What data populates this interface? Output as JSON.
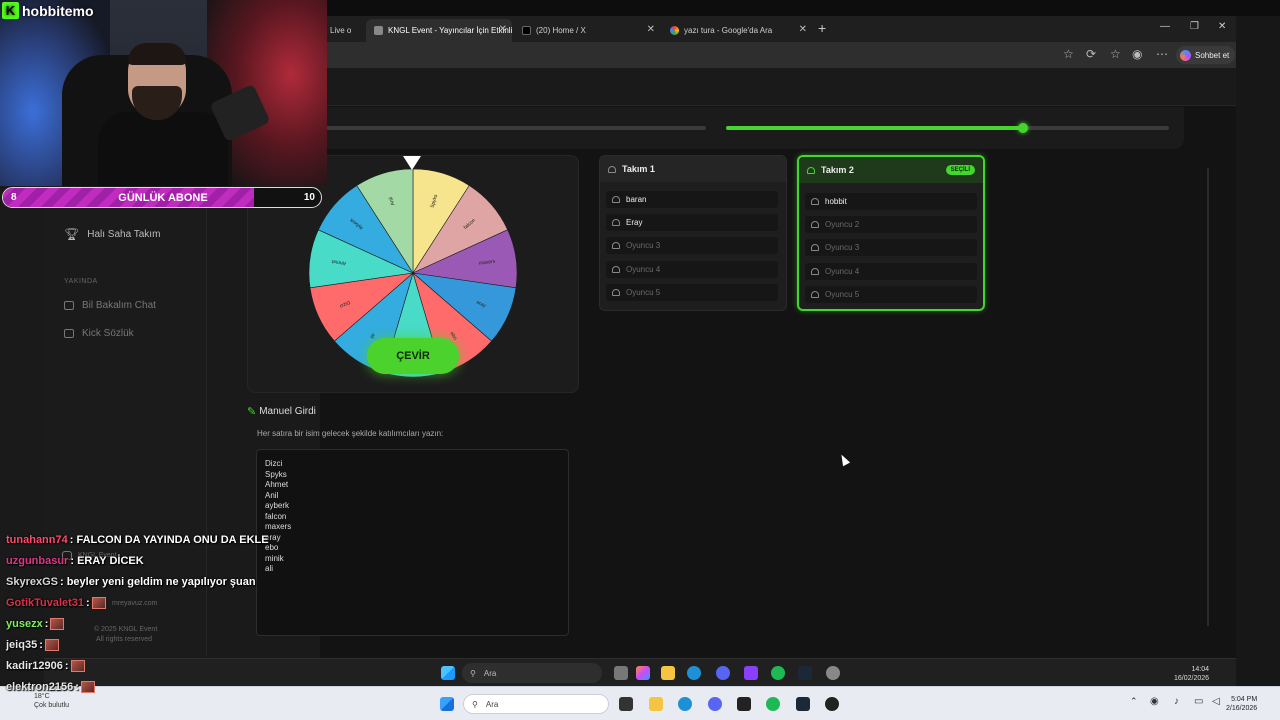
{
  "browser": {
    "tabs": [
      {
        "label": "Live o",
        "active": false
      },
      {
        "label": "KNGL Event - Yayıncılar İçin Etkinli",
        "active": true
      },
      {
        "label": "(20) Home / X",
        "active": false
      },
      {
        "label": "yazı tura - Google'da Ara",
        "active": false
      }
    ],
    "new_tab": "+",
    "sohbet_label": "Sohbet et"
  },
  "progress": {
    "value": 0.67
  },
  "sidebar": {
    "item_hali_saha": "Halı Saha Takım",
    "section_yakinda": "YAKINDA",
    "item_bil_bakalim": "Bil Bakalım Chat",
    "item_kick_sozluk": "Kick Sözlük",
    "social": "KNGL Event",
    "email": "mreyavuz.com",
    "copyright": "© 2025 KNGL Event",
    "rights": "All rights reserved"
  },
  "wheel": {
    "spin_label": "ÇEVİR",
    "segments": [
      {
        "label": "Spyks",
        "color": "#f6e58d"
      },
      {
        "label": "falcon",
        "color": "#dfa5a5"
      },
      {
        "label": "maxers",
        "color": "#9b59b6"
      },
      {
        "label": "eray",
        "color": "#3498db"
      },
      {
        "label": "ebo",
        "color": "#ff6b6b"
      },
      {
        "label": "minik",
        "color": "#48dbc8"
      },
      {
        "label": "ali",
        "color": "#34ace0"
      },
      {
        "label": "Dizci",
        "color": "#ff6b6b"
      },
      {
        "label": "Ahmet",
        "color": "#48dbc8"
      },
      {
        "label": "ayberk",
        "color": "#34ace0"
      },
      {
        "label": "Anil",
        "color": "#a3d9a5"
      }
    ]
  },
  "teams": [
    {
      "title": "Takım 1",
      "selected": false,
      "badge": "",
      "players": [
        {
          "name": "baran",
          "empty": false
        },
        {
          "name": "Eray",
          "empty": false
        },
        {
          "name": "Oyuncu 3",
          "empty": true
        },
        {
          "name": "Oyuncu 4",
          "empty": true
        },
        {
          "name": "Oyuncu 5",
          "empty": true
        }
      ]
    },
    {
      "title": "Takım 2",
      "selected": true,
      "badge": "SEÇİLİ",
      "players": [
        {
          "name": "hobbit",
          "empty": false
        },
        {
          "name": "Oyuncu 2",
          "empty": true
        },
        {
          "name": "Oyuncu 3",
          "empty": true
        },
        {
          "name": "Oyuncu 4",
          "empty": true
        },
        {
          "name": "Oyuncu 5",
          "empty": true
        }
      ]
    }
  ],
  "manual": {
    "title": "Manuel Girdi",
    "hint": "Her satıra bir isim gelecek şekilde katılımcıları yazın:",
    "names": [
      "Dizci",
      "Spyks",
      "Ahmet",
      "Anil",
      "ayberk",
      "falcon",
      "maxers",
      "eray",
      "ebo",
      "minik",
      "ali"
    ]
  },
  "taskbar_inner": {
    "search": "Ara",
    "time": "14:04",
    "date": "16/02/2026"
  },
  "taskbar_outer": {
    "search": "Ara",
    "temp": "18°C",
    "weather": "Çok bulutlu",
    "time": "5:04 PM",
    "date": "2/16/2026"
  },
  "stream": {
    "channel": "hobbitemo",
    "sub_goal": {
      "label": "GÜNLÜK ABONE",
      "start": "8",
      "end": "10",
      "progress": 0.79
    },
    "chat": [
      {
        "user": "tunahann74",
        "color": "#ff4a6a",
        "msg": ": FALCON DA YAYINDA ONU DA EKLE",
        "emote": false
      },
      {
        "user": "uzgunbasur",
        "color": "#e0368a",
        "msg": ": ERAY DİCEK",
        "emote": false
      },
      {
        "user": "SkyrexGS",
        "color": "#d8d8d8",
        "msg": ": beyler yeni geldim ne yapılıyor şuan",
        "emote": false
      },
      {
        "user": "GotikTuvalet31",
        "color": "#d8334a",
        "msg": ":",
        "emote": true
      },
      {
        "user": "yusezx",
        "color": "#7cf25a",
        "msg": ":",
        "emote": true
      },
      {
        "user": "jeiq35",
        "color": "#e8e8e8",
        "msg": ":",
        "emote": true
      },
      {
        "user": "kadir12906",
        "color": "#e8e8e8",
        "msg": ":",
        "emote": true
      },
      {
        "user": "elektron2156",
        "color": "#e8e8e8",
        "msg": ":",
        "emote": true
      }
    ]
  }
}
